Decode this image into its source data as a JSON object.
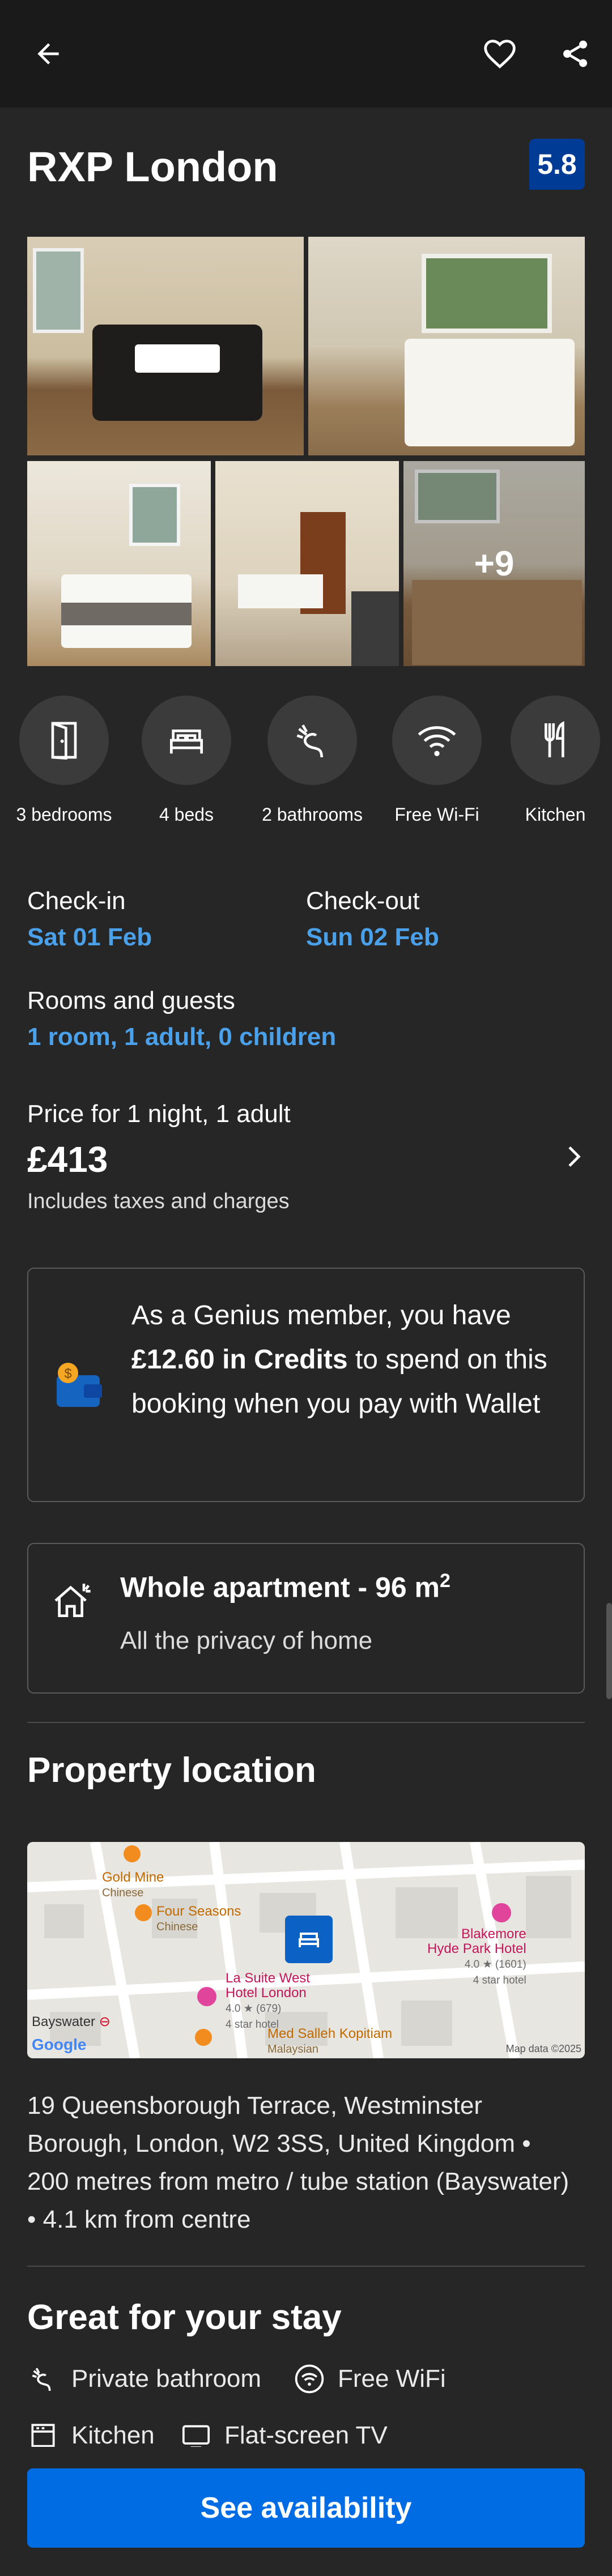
{
  "header": {
    "back_icon": "arrow-left-icon",
    "favorite_icon": "heart-outline-icon",
    "share_icon": "share-icon"
  },
  "property": {
    "name": "RXP London",
    "score": "5.8",
    "score_color": "#003b95",
    "more_photos": "+9"
  },
  "amenities": [
    {
      "label": "3 bedrooms",
      "icon": "door-icon"
    },
    {
      "label": "4 beds",
      "icon": "bed-icon"
    },
    {
      "label": "2 bathrooms",
      "icon": "shower-icon"
    },
    {
      "label": "Free Wi-Fi",
      "icon": "wifi-icon"
    },
    {
      "label": "Kitchen",
      "icon": "fork-knife-icon"
    }
  ],
  "booking": {
    "checkin_label": "Check-in",
    "checkin_value": "Sat 01 Feb",
    "checkout_label": "Check-out",
    "checkout_value": "Sun 02 Feb",
    "guests_label": "Rooms and guests",
    "guests_value": "1 room, 1 adult, 0 children",
    "price_label": "Price for 1 night, 1 adult",
    "price_value": "£413",
    "price_note": "Includes taxes and charges"
  },
  "genius": {
    "text_before": "As a Genius member, you have",
    "credits": "£12.60 in Credits",
    "text_after": "to spend on this booking when you pay with Wallet"
  },
  "apartment": {
    "title": "Whole apartment - 96 m",
    "superscript": "2",
    "subtitle": "All the privacy of home"
  },
  "location": {
    "title": "Property location",
    "address": "19 Queensborough Terrace, Westminster Borough, London, W2 3SS, United Kingdom • 200 metres from metro / tube station (Bayswater) • 4.1 km from centre",
    "map": {
      "poi_gold_mine": "Gold Mine",
      "poi_gold_mine_sub": "Chinese",
      "poi_four_seasons": "Four Seasons",
      "poi_four_seasons_sub": "Chinese",
      "poi_la_suite": "La Suite West",
      "poi_la_suite_2": "Hotel London",
      "poi_la_suite_rating": "4.0 ★ (679)",
      "poi_la_suite_star": "4 star hotel",
      "poi_blakemore": "Blakemore",
      "poi_blakemore_2": "Hyde Park Hotel",
      "poi_blakemore_rating": "4.0 ★ (1601)",
      "poi_blakemore_star": "4 star hotel",
      "poi_med": "Med Salleh Kopitiam",
      "poi_med_sub": "Malaysian",
      "station": "Bayswater",
      "google": "Google",
      "map_data": "Map data ©2025"
    }
  },
  "stay": {
    "title": "Great for your stay",
    "features": [
      {
        "label": "Private bathroom",
        "icon": "shower-icon"
      },
      {
        "label": "Free WiFi",
        "icon": "wifi-circle-icon"
      },
      {
        "label": "Kitchen",
        "icon": "kitchen-icon"
      },
      {
        "label": "Flat-screen TV",
        "icon": "tv-icon"
      }
    ]
  },
  "cta": {
    "label": "See availability",
    "color": "#006ce4"
  }
}
